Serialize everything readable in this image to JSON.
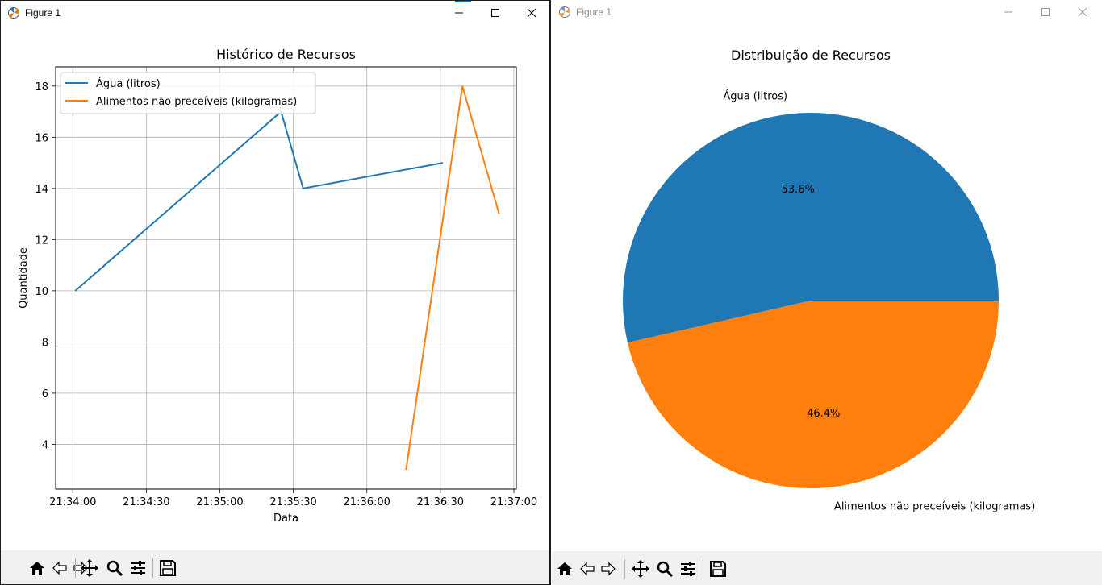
{
  "windows": [
    {
      "title": "Figure 1"
    },
    {
      "title": "Figure 1"
    }
  ],
  "chart_data": [
    {
      "type": "line",
      "title": "Histórico de Recursos",
      "xlabel": "Data",
      "ylabel": "Quantidade",
      "x_ticks": [
        "21:34:00",
        "21:34:30",
        "21:35:00",
        "21:35:30",
        "21:36:00",
        "21:36:30",
        "21:37:00"
      ],
      "y_ticks": [
        4,
        6,
        8,
        10,
        12,
        14,
        16,
        18
      ],
      "xlim": [
        "21:33:53",
        "21:37:01"
      ],
      "ylim": [
        2.25,
        18.75
      ],
      "grid": true,
      "legend_position": "upper-left",
      "series": [
        {
          "name": "Água (litros)",
          "color": "#1f77b4",
          "x": [
            "21:34:01",
            "21:35:25",
            "21:35:34",
            "21:36:31"
          ],
          "y": [
            10,
            17,
            14,
            15
          ]
        },
        {
          "name": "Alimentos não preceíveis (kilogramas)",
          "color": "#ff7f0e",
          "x": [
            "21:36:16",
            "21:36:39",
            "21:36:54"
          ],
          "y": [
            3,
            18,
            13
          ]
        }
      ]
    },
    {
      "type": "pie",
      "title": "Distribuição de Recursos",
      "slices": [
        {
          "label": "Água (litros)",
          "percent": 53.6,
          "percent_label": "53.6%",
          "color": "#1f77b4"
        },
        {
          "label": "Alimentos não preceíveis (kilogramas)",
          "percent": 46.4,
          "percent_label": "46.4%",
          "color": "#ff7f0e"
        }
      ]
    }
  ],
  "toolbar_icons": [
    "home-icon",
    "back-icon",
    "forward-icon",
    "pan-icon",
    "zoom-icon",
    "configure-subplots-icon",
    "save-icon"
  ]
}
